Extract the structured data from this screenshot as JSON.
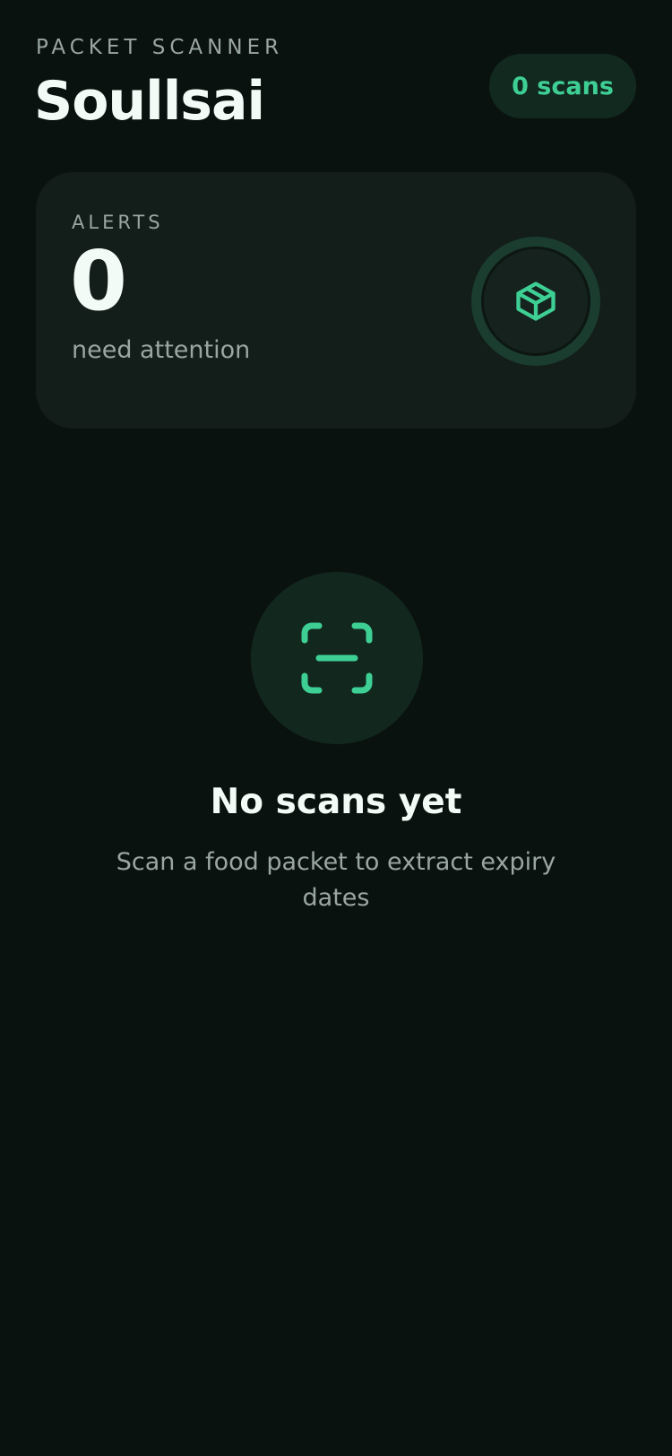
{
  "header": {
    "eyebrow": "PACKET SCANNER",
    "title": "Soullsai",
    "scan_count_label": "0 scans"
  },
  "alerts": {
    "label": "ALERTS",
    "count": "0",
    "subtitle": "need attention",
    "icon": "box-icon"
  },
  "empty_state": {
    "icon": "scan-icon",
    "title": "No scans yet",
    "description": "Scan a food packet to extract expiry dates"
  },
  "colors": {
    "background": "#0a120f",
    "card": "#131d19",
    "accent": "#3ecf95",
    "text_primary": "#f2fbf6",
    "text_secondary": "#9aa6a1"
  }
}
